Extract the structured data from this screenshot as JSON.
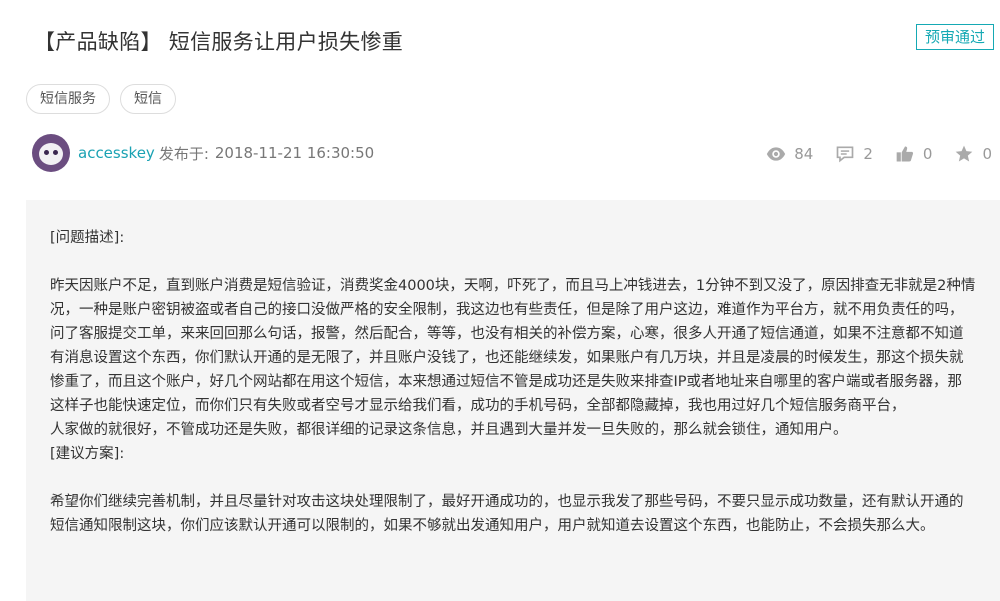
{
  "post": {
    "title": "【产品缺陷】 短信服务让用户损失惨重",
    "status": "预审通过",
    "tags": [
      "短信服务",
      "短信"
    ],
    "author": "accesskey",
    "posted_prefix": "发布于:",
    "posted_time": "2018-11-21 16:30:50",
    "stats": {
      "views": "84",
      "comments": "2",
      "likes": "0",
      "favorites": "0"
    }
  },
  "content": {
    "problem_heading": "[问题描述]:",
    "problem_body": "昨天因账户不足，直到账户消费是短信验证，消费奖金4000块，天啊，吓死了，而且马上冲钱进去，1分钟不到又没了，原因排查无非就是2种情况，一种是账户密钥被盗或者自己的接口没做严格的安全限制，我这边也有些责任，但是除了用户这边，难道作为平台方，就不用负责任的吗，问了客服提交工单，来来回回那么句话，报警，然后配合，等等，也没有相关的补偿方案，心寒，很多人开通了短信通道，如果不注意都不知道有消息设置这个东西，你们默认开通的是无限了，并且账户没钱了，也还能继续发，如果账户有几万块，并且是凌晨的时候发生，那这个损失就惨重了，而且这个账户，好几个网站都在用这个短信，本来想通过短信不管是成功还是失败来排查IP或者地址来自哪里的客户端或者服务器，那这样子也能快速定位，而你们只有失败或者空号才显示给我们看，成功的手机号码，全部都隐藏掉，我也用过好几个短信服务商平台，　　　　　　　　人家做的就很好，不管成功还是失败，都很详细的记录这条信息，并且遇到大量并发一旦失败的，那么就会锁住，通知用户。",
    "suggestion_heading": "[建议方案]:",
    "suggestion_body": "希望你们继续完善机制，并且尽量针对攻击这块处理限制了，最好开通成功的，也显示我发了那些号码，不要只显示成功数量，还有默认开通的短信通知限制这块，你们应该默认开通可以限制的，如果不够就出发通知用户，用户就知道去设置这个东西，也能防止，不会损失那么大。"
  },
  "icons": [
    "eye-icon",
    "comment-icon",
    "thumbs-up-icon",
    "star-icon"
  ],
  "colors": {
    "accent": "#15a9b4",
    "content_bg": "#f5f5f5"
  }
}
